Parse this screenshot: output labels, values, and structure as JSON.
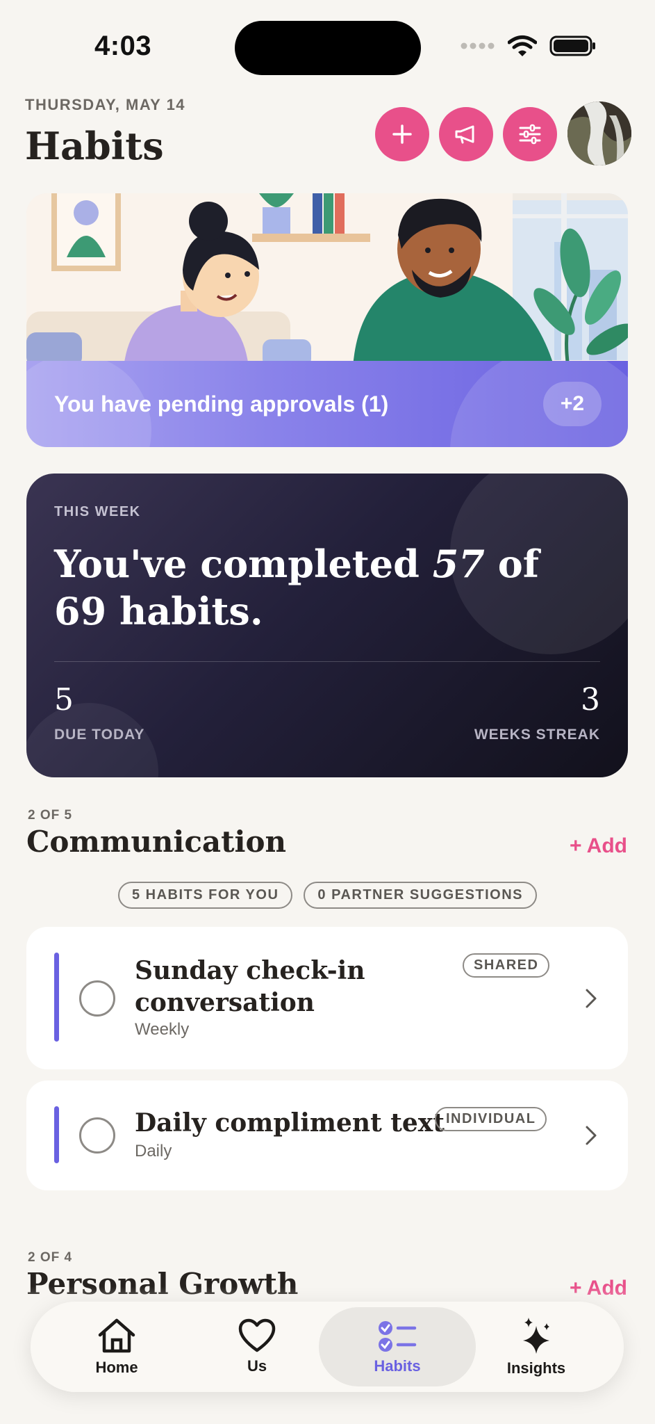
{
  "status": {
    "time": "4:03"
  },
  "header": {
    "date": "THURSDAY, MAY 14",
    "title": "Habits",
    "icons": [
      "plus-icon",
      "megaphone-icon",
      "sliders-icon"
    ]
  },
  "hero": {
    "pending_text": "You have pending approvals (1)",
    "extra_count": "+2"
  },
  "week": {
    "eyebrow": "THIS WEEK",
    "prefix": "You've completed",
    "completed": "57",
    "middle": "of 69",
    "suffix": "habits.",
    "due_value": "5",
    "due_label": "DUE TODAY",
    "streak_value": "3",
    "streak_label": "WEEKS STREAK"
  },
  "sections": [
    {
      "count": "2 OF 5",
      "title": "Communication",
      "add_label": "+ Add",
      "chips": [
        "5 HABITS FOR YOU",
        "0 PARTNER SUGGESTIONS"
      ],
      "habits": [
        {
          "name_line1": "Sunday check-in",
          "name_line2": "conversation",
          "frequency": "Weekly",
          "tag": "SHARED"
        },
        {
          "name_line1": "Daily compliment text",
          "frequency": "Daily",
          "tag": "INDIVIDUAL"
        }
      ]
    },
    {
      "count": "2 OF 4",
      "title": "Personal Growth",
      "add_label": "+ Add"
    }
  ],
  "nav": {
    "items": [
      {
        "label": "Home",
        "icon": "home-icon"
      },
      {
        "label": "Us",
        "icon": "heart-icon"
      },
      {
        "label": "Habits",
        "icon": "checklist-icon",
        "active": true
      },
      {
        "label": "Insights",
        "icon": "sparkle-icon"
      }
    ]
  },
  "colors": {
    "accent_pink": "#e8508a",
    "accent_purple": "#6a61e1",
    "background": "#f7f5f1"
  }
}
